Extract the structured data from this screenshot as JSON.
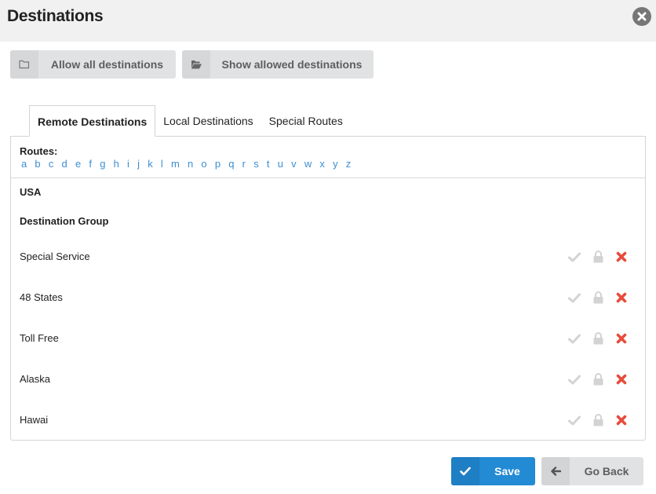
{
  "header": {
    "title": "Destinations",
    "close_icon": "times-circle-icon"
  },
  "toolbar": {
    "allow_all_label": "Allow all destinations",
    "allow_all_icon": "folder-outline-icon",
    "show_allowed_label": "Show allowed destinations",
    "show_allowed_icon": "folder-open-icon"
  },
  "tabs": [
    {
      "label": "Remote Destinations",
      "active": true
    },
    {
      "label": "Local Destinations",
      "active": false
    },
    {
      "label": "Special Routes",
      "active": false
    }
  ],
  "routes": {
    "label": "Routes:",
    "letters": [
      "a",
      "b",
      "c",
      "d",
      "e",
      "f",
      "g",
      "h",
      "i",
      "j",
      "k",
      "l",
      "m",
      "n",
      "o",
      "p",
      "q",
      "r",
      "s",
      "t",
      "u",
      "v",
      "w",
      "x",
      "y",
      "z"
    ]
  },
  "country": "USA",
  "group_header": "Destination Group",
  "destinations": [
    {
      "name": "Special Service"
    },
    {
      "name": "48 States"
    },
    {
      "name": "Toll Free"
    },
    {
      "name": "Alaska"
    },
    {
      "name": "Hawai"
    }
  ],
  "row_actions": {
    "allow_icon": "check-icon",
    "lock_icon": "lock-icon",
    "deny_icon": "times-icon"
  },
  "footer": {
    "save_label": "Save",
    "save_icon": "check-icon",
    "back_label": "Go Back",
    "back_icon": "arrow-left-icon"
  },
  "colors": {
    "primary": "#238ad4",
    "link": "#3d8ed1",
    "deny": "#e74c3c",
    "muted_icon": "#d0d0d0"
  }
}
